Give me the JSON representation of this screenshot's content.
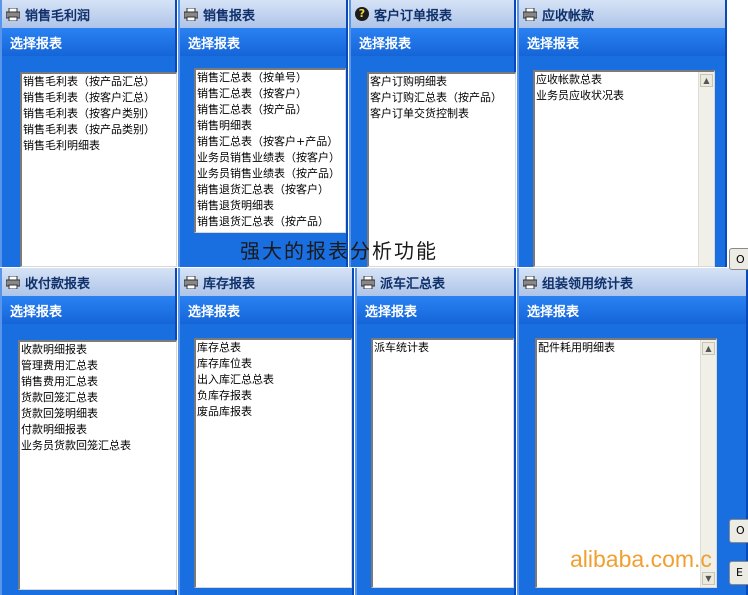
{
  "caption": "强大的报表分析功能",
  "watermark": "alibaba.com.c",
  "windows": [
    {
      "title": "销售毛利润",
      "icon": "printer-icon",
      "header": "选择报表",
      "items": [
        "销售毛利表（按产品汇总）",
        "销售毛利表（按客户汇总）",
        "销售毛利表（按客户类别）",
        "销售毛利表（按产品类别）",
        "销售毛利明细表"
      ]
    },
    {
      "title": "销售报表",
      "icon": "printer-icon",
      "header": "选择报表",
      "items": [
        "销售汇总表（按单号）",
        "销售汇总表（按客户）",
        "销售汇总表（按产品）",
        "销售明细表",
        "销售汇总表（按客户+产品）",
        "业务员销售业绩表（按客户）",
        "业务员销售业绩表（按产品）",
        "销售退货汇总表（按客户）",
        "销售退货明细表",
        "销售退货汇总表（按产品）"
      ]
    },
    {
      "title": "客户订单报表",
      "icon": "help-icon",
      "header": "选择报表",
      "items": [
        "客户订购明细表",
        "客户订购汇总表（按产品）",
        "客户订单交货控制表"
      ]
    },
    {
      "title": "应收帐款",
      "icon": "printer-icon",
      "header": "选择报表",
      "items": [
        "应收帐款总表",
        "业务员应收状况表"
      ]
    },
    {
      "title": "收付款报表",
      "icon": "printer-icon",
      "header": "选择报表",
      "items": [
        "收款明细报表",
        "管理费用汇总表",
        "销售费用汇总表",
        "货款回笼汇总表",
        "货款回笼明细表",
        "付款明细报表",
        "业务员货款回笼汇总表"
      ]
    },
    {
      "title": "库存报表",
      "icon": "printer-icon",
      "header": "选择报表",
      "items": [
        "库存总表",
        "库存库位表",
        "出入库汇总总表",
        "负库存报表",
        "废品库报表"
      ]
    },
    {
      "title": "派车汇总表",
      "icon": "printer-icon",
      "header": "选择报表",
      "items": [
        "派车统计表"
      ]
    },
    {
      "title": "组装领用统计表",
      "icon": "printer-icon",
      "header": "选择报表",
      "items": [
        "配件耗用明细表"
      ]
    }
  ],
  "side_buttons": [
    "O",
    "O",
    "E"
  ]
}
